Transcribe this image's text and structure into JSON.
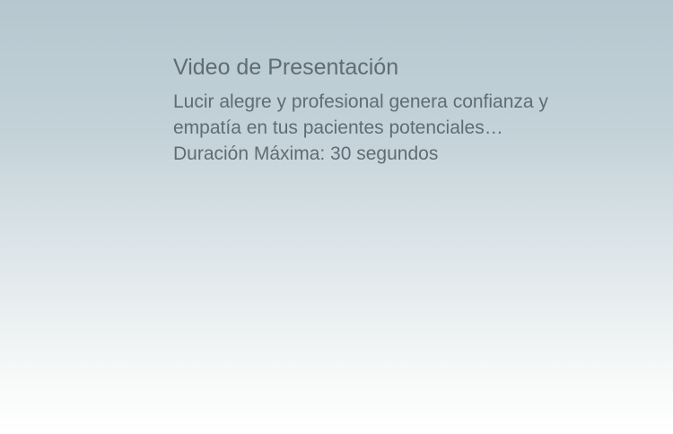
{
  "presentation": {
    "title": "Video de Presentación",
    "description_line1": "Lucir alegre y profesional genera confianza y",
    "description_line2": "empatía en tus pacientes potenciales…",
    "duration": "Duración Máxima: 30 segundos"
  },
  "colors": {
    "text": "#5f6c76",
    "gradient_top": "#b6c7cf",
    "gradient_bottom": "#ffffff"
  }
}
